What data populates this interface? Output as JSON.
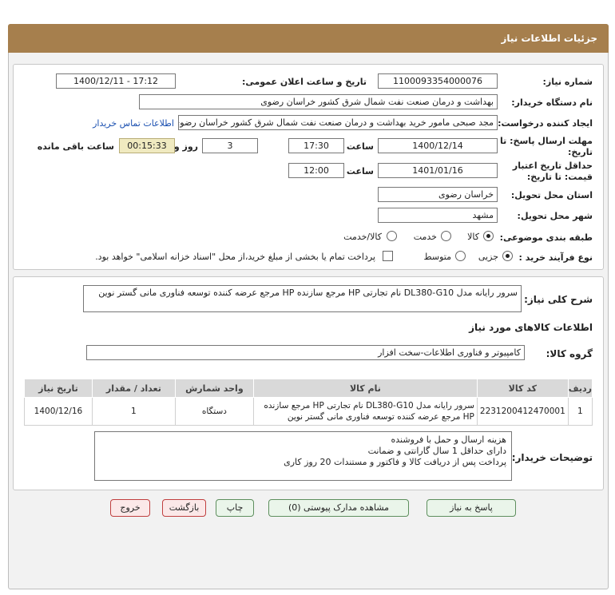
{
  "header": {
    "title": "جزئیات اطلاعات نیاز"
  },
  "form": {
    "need_number_label": "شماره نیاز:",
    "need_number": "1100093354000076",
    "announce_label": "تاریخ و ساعت اعلان عمومی:",
    "announce_value": "1400/12/11 - 17:12",
    "buyer_org_label": "نام دستگاه خریدار:",
    "buyer_org": "بهداشت و درمان صنعت نفت شمال شرق کشور   خراسان رضوی",
    "requester_label": "ایجاد کننده درخواست:",
    "requester": "مجد صبحی مامور خرید بهداشت و درمان صنعت نفت شمال شرق کشور   خراسان رضوی",
    "contact_link": "اطلاعات تماس خریدار",
    "deadline_label_1": "مهلت ارسال پاسخ: تا",
    "deadline_label_2": "تاریخ:",
    "deadline_date": "1400/12/14",
    "time_label": "ساعت",
    "deadline_time": "17:30",
    "days_value": "3",
    "days_label": "روز و",
    "remaining_time": "00:15:33",
    "remaining_label": "ساعت باقی مانده",
    "validity_label_1": "حداقل تاریخ اعتبار",
    "validity_label_2": "قیمت: تا تاریخ:",
    "validity_date": "1401/01/16",
    "validity_time": "12:00",
    "province_label": "استان محل تحویل:",
    "province": "خراسان رضوی",
    "city_label": "شهر محل تحویل:",
    "city": "مشهد",
    "category_label": "طبقه بندی موضوعی:",
    "category_options": [
      "کالا",
      "خدمت",
      "کالا/خدمت"
    ],
    "category_selected": "کالا",
    "process_label": "نوع فرآیند خرید :",
    "process_options": [
      "جزیی",
      "متوسط"
    ],
    "process_selected": "جزیی",
    "payment_note": "پرداخت تمام یا بخشی از مبلغ خرید،از محل \"اسناد خزانه اسلامی\" خواهد بود."
  },
  "summary": {
    "label": "شرح کلی نیاز:",
    "text": "سرور رایانه مدل DL380-G10 نام تجارتی HP مرجع سازنده HP مرجع عرضه کننده توسعه فناوری مانی گستر نوین"
  },
  "goods": {
    "section_title": "اطلاعات کالاهای مورد نیاز",
    "group_label": "گروه کالا:",
    "group_value": "کامپیوتر و فناوری اطلاعات-سخت افزار",
    "columns": [
      "ردیف",
      "کد کالا",
      "نام کالا",
      "واحد شمارش",
      "تعداد / مقدار",
      "تاریخ نیاز"
    ],
    "rows": [
      {
        "row": "1",
        "code": "2231200412470001",
        "name": "سرور رایانه مدل DL380-G10 نام تجارتی HP مرجع سازنده HP مرجع عرضه کننده توسعه فناوری مانی گستر نوین",
        "unit": "دستگاه",
        "qty": "1",
        "date": "1400/12/16"
      }
    ]
  },
  "buyer_notes": {
    "label": "توضیحات خریدار:",
    "lines": [
      "هزینه ارسال و حمل با فروشنده",
      "دارای حداقل 1 سال گارانتی و ضمانت",
      "پرداخت پس از دریافت کالا و فاکتور و مستندات 20 روز کاری"
    ]
  },
  "buttons": {
    "reply": "پاسخ به نیاز",
    "attachments": "مشاهده مدارک پیوستی (0)",
    "print": "چاپ",
    "back": "بازگشت",
    "exit": "خروج"
  },
  "colors": {
    "header": "#a67f4d",
    "link": "#1a4fb0",
    "timer_bg": "#f0eac0"
  }
}
